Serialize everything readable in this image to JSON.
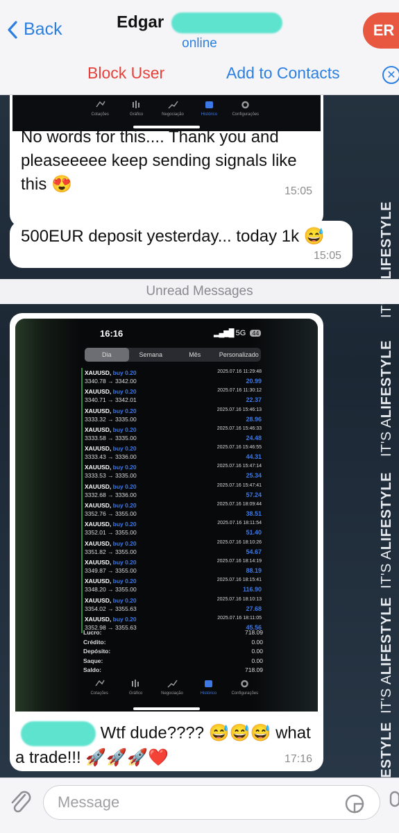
{
  "header": {
    "back_label": "Back",
    "contact_name": "Edgar",
    "status": "online",
    "avatar_initials": "ER",
    "block_label": "Block User",
    "add_contacts_label": "Add to Contacts"
  },
  "chat": {
    "top_screenshot_tabs": [
      "Cotações",
      "Gráfico",
      "Negociação",
      "Histórico",
      "Configurações"
    ],
    "messages": [
      {
        "text": "No words for this.... Thank you and pleaseeeee keep sending signals like this 😍",
        "time": "15:05"
      },
      {
        "text": "500EUR deposit yesterday... today 1k 😅",
        "time": "15:05"
      }
    ],
    "unread_label": "Unread Messages",
    "wallpaper_text": {
      "prefix": "IT'S A",
      "bold": "LIFESTYLE"
    },
    "screenshot": {
      "status_time": "16:16",
      "status_network": "5G",
      "status_battery": "44",
      "filter_tabs": [
        "Dia",
        "Semana",
        "Mês",
        "Personalizado"
      ],
      "active_filter": "Dia",
      "trades": [
        {
          "symbol": "XAUUSD,",
          "side": "buy 0.20",
          "prices": "3340.78 → 3342.00",
          "datetime": "2025.07.16 11:29:48",
          "profit": "20.99"
        },
        {
          "symbol": "XAUUSD,",
          "side": "buy 0.20",
          "prices": "3340.71 → 3342.01",
          "datetime": "2025.07.16 11:30:12",
          "profit": "22.37"
        },
        {
          "symbol": "XAUUSD,",
          "side": "buy 0.20",
          "prices": "3333.32 → 3335.00",
          "datetime": "2025.07.16 15:46:13",
          "profit": "28.96"
        },
        {
          "symbol": "XAUUSD,",
          "side": "buy 0.20",
          "prices": "3333.58 → 3335.00",
          "datetime": "2025.07.16 15:46:33",
          "profit": "24.48"
        },
        {
          "symbol": "XAUUSD,",
          "side": "buy 0.20",
          "prices": "3333.43 → 3336.00",
          "datetime": "2025.07.16 15:46:55",
          "profit": "44.31"
        },
        {
          "symbol": "XAUUSD,",
          "side": "buy 0.20",
          "prices": "3333.53 → 3335.00",
          "datetime": "2025.07.16 15:47:14",
          "profit": "25.34"
        },
        {
          "symbol": "XAUUSD,",
          "side": "buy 0.20",
          "prices": "3332.68 → 3336.00",
          "datetime": "2025.07.16 15:47:41",
          "profit": "57.24"
        },
        {
          "symbol": "XAUUSD,",
          "side": "buy 0.20",
          "prices": "3352.76 → 3355.00",
          "datetime": "2025.07.16 18:09:44",
          "profit": "38.51"
        },
        {
          "symbol": "XAUUSD,",
          "side": "buy 0.20",
          "prices": "3352.01 → 3355.00",
          "datetime": "2025.07.16 18:11:54",
          "profit": "51.40"
        },
        {
          "symbol": "XAUUSD,",
          "side": "buy 0.20",
          "prices": "3351.82 → 3355.00",
          "datetime": "2025.07.16 18:10:26",
          "profit": "54.67"
        },
        {
          "symbol": "XAUUSD,",
          "side": "buy 0.20",
          "prices": "3349.87 → 3355.00",
          "datetime": "2025.07.16 18:14:19",
          "profit": "88.19"
        },
        {
          "symbol": "XAUUSD,",
          "side": "buy 0.20",
          "prices": "3348.20 → 3355.00",
          "datetime": "2025.07.16 18:15:41",
          "profit": "116.90"
        },
        {
          "symbol": "XAUUSD,",
          "side": "buy 0.20",
          "prices": "3354.02 → 3355.63",
          "datetime": "2025.07.16 18:10:13",
          "profit": "27.68"
        },
        {
          "symbol": "XAUUSD,",
          "side": "buy 0.20",
          "prices": "3352.98 → 3355.63",
          "datetime": "2025.07.16 18:11:05",
          "profit": "45.56"
        }
      ],
      "summary": [
        {
          "label": "Lucro:",
          "value": "718.09"
        },
        {
          "label": "Crédito:",
          "value": "0.00"
        },
        {
          "label": "Depósito:",
          "value": "0.00"
        },
        {
          "label": "Saque:",
          "value": "0.00"
        },
        {
          "label": "Saldo:",
          "value": "718.09"
        }
      ],
      "bottom_tabs": [
        "Cotações",
        "Gráfico",
        "Negociação",
        "Histórico",
        "Configurações"
      ],
      "active_bottom_tab": "Histórico",
      "caption": "Wtf dude???? 😅😅😅 what a trade!!! 🚀🚀🚀❤️",
      "caption_time": "17:16"
    }
  },
  "composer": {
    "placeholder": "Message"
  },
  "colors": {
    "accent": "#2c7fe0",
    "danger": "#e5413a",
    "avatar": "#e8573f",
    "profit_blue": "#3d79e6"
  }
}
